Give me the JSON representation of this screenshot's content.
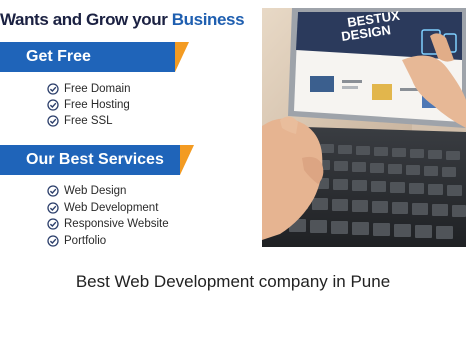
{
  "banner": {
    "headline_part1": "Wants and Grow your ",
    "headline_part2": "Business",
    "section1_title": "Get Free",
    "section1_items": [
      "Free Domain",
      "Free Hosting",
      "Free SSL"
    ],
    "section2_title": "Our Best Services",
    "section2_items": [
      "Web Design",
      "Web Development",
      "Responsive Website",
      "Portfolio"
    ],
    "photo_screen_text": [
      "BESTUX",
      "DESIGN"
    ]
  },
  "caption": "Best Web Development company in Pune",
  "colors": {
    "brand_blue": "#1f64b9",
    "accent_orange": "#f39b22",
    "headline_dark": "#1b2142"
  }
}
